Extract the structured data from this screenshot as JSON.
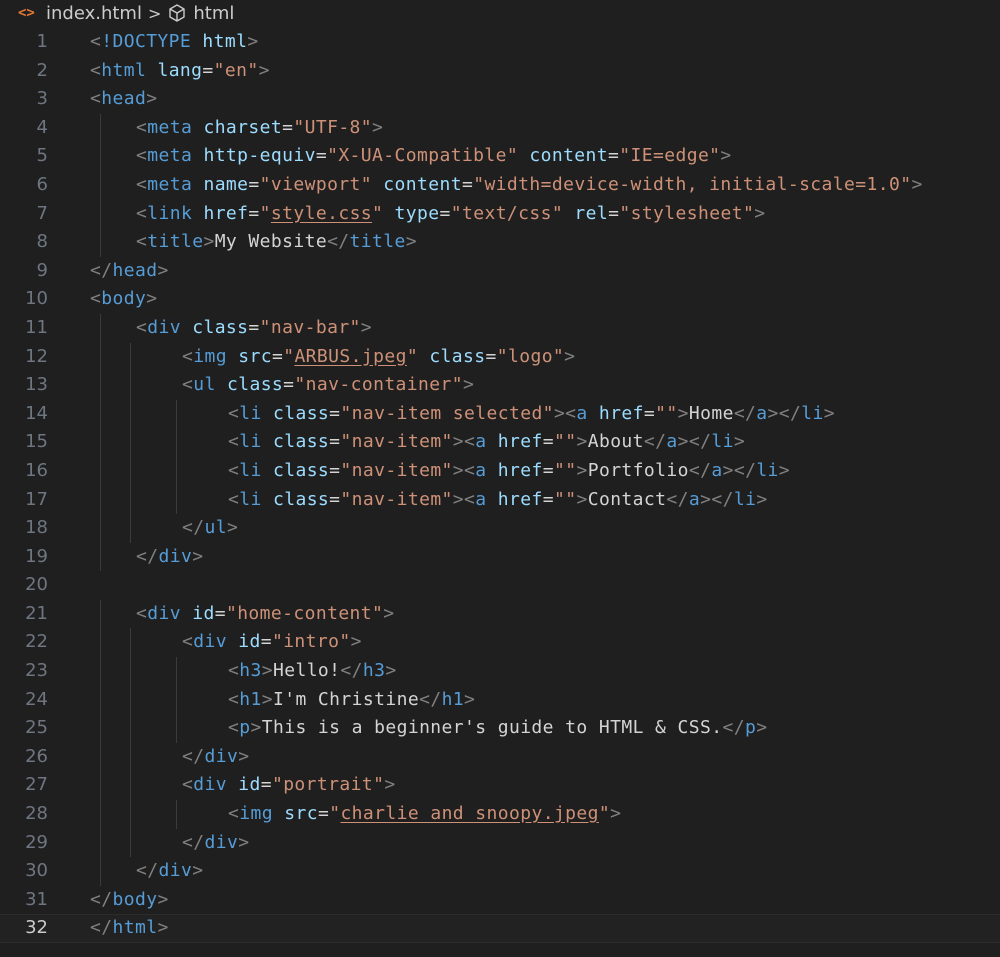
{
  "breadcrumb": {
    "file": "index.html",
    "separator": ">",
    "symbol": "html",
    "file_icon": "html-file-icon",
    "symbol_icon": "cube-icon"
  },
  "editor": {
    "current_line": 32,
    "lines": [
      {
        "n": "1",
        "indent": 0,
        "tokens": [
          [
            "p",
            "<"
          ],
          [
            "t",
            "!DOCTYPE"
          ],
          [
            "x",
            " "
          ],
          [
            "a",
            "html"
          ],
          [
            "p",
            ">"
          ]
        ]
      },
      {
        "n": "2",
        "indent": 0,
        "tokens": [
          [
            "p",
            "<"
          ],
          [
            "t",
            "html"
          ],
          [
            "x",
            " "
          ],
          [
            "a",
            "lang"
          ],
          [
            "x",
            "="
          ],
          [
            "s",
            "\"en\""
          ],
          [
            "p",
            ">"
          ]
        ]
      },
      {
        "n": "3",
        "indent": 0,
        "tokens": [
          [
            "p",
            "<"
          ],
          [
            "t",
            "head"
          ],
          [
            "p",
            ">"
          ]
        ]
      },
      {
        "n": "4",
        "indent": 1,
        "tokens": [
          [
            "p",
            "<"
          ],
          [
            "t",
            "meta"
          ],
          [
            "x",
            " "
          ],
          [
            "a",
            "charset"
          ],
          [
            "x",
            "="
          ],
          [
            "s",
            "\"UTF-8\""
          ],
          [
            "p",
            ">"
          ]
        ]
      },
      {
        "n": "5",
        "indent": 1,
        "tokens": [
          [
            "p",
            "<"
          ],
          [
            "t",
            "meta"
          ],
          [
            "x",
            " "
          ],
          [
            "a",
            "http-equiv"
          ],
          [
            "x",
            "="
          ],
          [
            "s",
            "\"X-UA-Compatible\""
          ],
          [
            "x",
            " "
          ],
          [
            "a",
            "content"
          ],
          [
            "x",
            "="
          ],
          [
            "s",
            "\"IE=edge\""
          ],
          [
            "p",
            ">"
          ]
        ]
      },
      {
        "n": "6",
        "indent": 1,
        "tokens": [
          [
            "p",
            "<"
          ],
          [
            "t",
            "meta"
          ],
          [
            "x",
            " "
          ],
          [
            "a",
            "name"
          ],
          [
            "x",
            "="
          ],
          [
            "s",
            "\"viewport\""
          ],
          [
            "x",
            " "
          ],
          [
            "a",
            "content"
          ],
          [
            "x",
            "="
          ],
          [
            "s",
            "\"width=device-width, initial-scale=1.0\""
          ],
          [
            "p",
            ">"
          ]
        ]
      },
      {
        "n": "7",
        "indent": 1,
        "tokens": [
          [
            "p",
            "<"
          ],
          [
            "t",
            "link"
          ],
          [
            "x",
            " "
          ],
          [
            "a",
            "href"
          ],
          [
            "x",
            "="
          ],
          [
            "s",
            "\""
          ],
          [
            "u",
            "style.css"
          ],
          [
            "s",
            "\""
          ],
          [
            "x",
            " "
          ],
          [
            "a",
            "type"
          ],
          [
            "x",
            "="
          ],
          [
            "s",
            "\"text/css\""
          ],
          [
            "x",
            " "
          ],
          [
            "a",
            "rel"
          ],
          [
            "x",
            "="
          ],
          [
            "s",
            "\"stylesheet\""
          ],
          [
            "p",
            ">"
          ]
        ]
      },
      {
        "n": "8",
        "indent": 1,
        "tokens": [
          [
            "p",
            "<"
          ],
          [
            "t",
            "title"
          ],
          [
            "p",
            ">"
          ],
          [
            "x",
            "My Website"
          ],
          [
            "p",
            "</"
          ],
          [
            "t",
            "title"
          ],
          [
            "p",
            ">"
          ]
        ]
      },
      {
        "n": "9",
        "indent": 0,
        "tokens": [
          [
            "p",
            "</"
          ],
          [
            "t",
            "head"
          ],
          [
            "p",
            ">"
          ]
        ]
      },
      {
        "n": "10",
        "indent": 0,
        "tokens": [
          [
            "p",
            "<"
          ],
          [
            "t",
            "body"
          ],
          [
            "p",
            ">"
          ]
        ]
      },
      {
        "n": "11",
        "indent": 1,
        "tokens": [
          [
            "p",
            "<"
          ],
          [
            "t",
            "div"
          ],
          [
            "x",
            " "
          ],
          [
            "a",
            "class"
          ],
          [
            "x",
            "="
          ],
          [
            "s",
            "\"nav-bar\""
          ],
          [
            "p",
            ">"
          ]
        ]
      },
      {
        "n": "12",
        "indent": 2,
        "tokens": [
          [
            "p",
            "<"
          ],
          [
            "t",
            "img"
          ],
          [
            "x",
            " "
          ],
          [
            "a",
            "src"
          ],
          [
            "x",
            "="
          ],
          [
            "s",
            "\""
          ],
          [
            "u",
            "ARBUS.jpeg"
          ],
          [
            "s",
            "\""
          ],
          [
            "x",
            " "
          ],
          [
            "a",
            "class"
          ],
          [
            "x",
            "="
          ],
          [
            "s",
            "\"logo\""
          ],
          [
            "p",
            ">"
          ]
        ]
      },
      {
        "n": "13",
        "indent": 2,
        "tokens": [
          [
            "p",
            "<"
          ],
          [
            "t",
            "ul"
          ],
          [
            "x",
            " "
          ],
          [
            "a",
            "class"
          ],
          [
            "x",
            "="
          ],
          [
            "s",
            "\"nav-container\""
          ],
          [
            "p",
            ">"
          ]
        ]
      },
      {
        "n": "14",
        "indent": 3,
        "tokens": [
          [
            "p",
            "<"
          ],
          [
            "t",
            "li"
          ],
          [
            "x",
            " "
          ],
          [
            "a",
            "class"
          ],
          [
            "x",
            "="
          ],
          [
            "s",
            "\"nav-item selected\""
          ],
          [
            "p",
            "><"
          ],
          [
            "t",
            "a"
          ],
          [
            "x",
            " "
          ],
          [
            "a",
            "href"
          ],
          [
            "x",
            "="
          ],
          [
            "s",
            "\"\""
          ],
          [
            "p",
            ">"
          ],
          [
            "x",
            "Home"
          ],
          [
            "p",
            "</"
          ],
          [
            "t",
            "a"
          ],
          [
            "p",
            "></"
          ],
          [
            "t",
            "li"
          ],
          [
            "p",
            ">"
          ]
        ]
      },
      {
        "n": "15",
        "indent": 3,
        "tokens": [
          [
            "p",
            "<"
          ],
          [
            "t",
            "li"
          ],
          [
            "x",
            " "
          ],
          [
            "a",
            "class"
          ],
          [
            "x",
            "="
          ],
          [
            "s",
            "\"nav-item\""
          ],
          [
            "p",
            "><"
          ],
          [
            "t",
            "a"
          ],
          [
            "x",
            " "
          ],
          [
            "a",
            "href"
          ],
          [
            "x",
            "="
          ],
          [
            "s",
            "\"\""
          ],
          [
            "p",
            ">"
          ],
          [
            "x",
            "About"
          ],
          [
            "p",
            "</"
          ],
          [
            "t",
            "a"
          ],
          [
            "p",
            "></"
          ],
          [
            "t",
            "li"
          ],
          [
            "p",
            ">"
          ]
        ]
      },
      {
        "n": "16",
        "indent": 3,
        "tokens": [
          [
            "p",
            "<"
          ],
          [
            "t",
            "li"
          ],
          [
            "x",
            " "
          ],
          [
            "a",
            "class"
          ],
          [
            "x",
            "="
          ],
          [
            "s",
            "\"nav-item\""
          ],
          [
            "p",
            "><"
          ],
          [
            "t",
            "a"
          ],
          [
            "x",
            " "
          ],
          [
            "a",
            "href"
          ],
          [
            "x",
            "="
          ],
          [
            "s",
            "\"\""
          ],
          [
            "p",
            ">"
          ],
          [
            "x",
            "Portfolio"
          ],
          [
            "p",
            "</"
          ],
          [
            "t",
            "a"
          ],
          [
            "p",
            "></"
          ],
          [
            "t",
            "li"
          ],
          [
            "p",
            ">"
          ]
        ]
      },
      {
        "n": "17",
        "indent": 3,
        "tokens": [
          [
            "p",
            "<"
          ],
          [
            "t",
            "li"
          ],
          [
            "x",
            " "
          ],
          [
            "a",
            "class"
          ],
          [
            "x",
            "="
          ],
          [
            "s",
            "\"nav-item\""
          ],
          [
            "p",
            "><"
          ],
          [
            "t",
            "a"
          ],
          [
            "x",
            " "
          ],
          [
            "a",
            "href"
          ],
          [
            "x",
            "="
          ],
          [
            "s",
            "\"\""
          ],
          [
            "p",
            ">"
          ],
          [
            "x",
            "Contact"
          ],
          [
            "p",
            "</"
          ],
          [
            "t",
            "a"
          ],
          [
            "p",
            "></"
          ],
          [
            "t",
            "li"
          ],
          [
            "p",
            ">"
          ]
        ]
      },
      {
        "n": "18",
        "indent": 2,
        "tokens": [
          [
            "p",
            "</"
          ],
          [
            "t",
            "ul"
          ],
          [
            "p",
            ">"
          ]
        ]
      },
      {
        "n": "19",
        "indent": 1,
        "tokens": [
          [
            "p",
            "</"
          ],
          [
            "t",
            "div"
          ],
          [
            "p",
            ">"
          ]
        ]
      },
      {
        "n": "20",
        "indent": 0,
        "tokens": []
      },
      {
        "n": "21",
        "indent": 1,
        "tokens": [
          [
            "p",
            "<"
          ],
          [
            "t",
            "div"
          ],
          [
            "x",
            " "
          ],
          [
            "a",
            "id"
          ],
          [
            "x",
            "="
          ],
          [
            "s",
            "\"home-content\""
          ],
          [
            "p",
            ">"
          ]
        ]
      },
      {
        "n": "22",
        "indent": 2,
        "tokens": [
          [
            "p",
            "<"
          ],
          [
            "t",
            "div"
          ],
          [
            "x",
            " "
          ],
          [
            "a",
            "id"
          ],
          [
            "x",
            "="
          ],
          [
            "s",
            "\"intro\""
          ],
          [
            "p",
            ">"
          ]
        ]
      },
      {
        "n": "23",
        "indent": 3,
        "tokens": [
          [
            "p",
            "<"
          ],
          [
            "t",
            "h3"
          ],
          [
            "p",
            ">"
          ],
          [
            "x",
            "Hello!"
          ],
          [
            "p",
            "</"
          ],
          [
            "t",
            "h3"
          ],
          [
            "p",
            ">"
          ]
        ]
      },
      {
        "n": "24",
        "indent": 3,
        "tokens": [
          [
            "p",
            "<"
          ],
          [
            "t",
            "h1"
          ],
          [
            "p",
            ">"
          ],
          [
            "x",
            "I'm Christine"
          ],
          [
            "p",
            "</"
          ],
          [
            "t",
            "h1"
          ],
          [
            "p",
            ">"
          ]
        ]
      },
      {
        "n": "25",
        "indent": 3,
        "tokens": [
          [
            "p",
            "<"
          ],
          [
            "t",
            "p"
          ],
          [
            "p",
            ">"
          ],
          [
            "x",
            "This is a beginner's guide to HTML & CSS."
          ],
          [
            "p",
            "</"
          ],
          [
            "t",
            "p"
          ],
          [
            "p",
            ">"
          ]
        ]
      },
      {
        "n": "26",
        "indent": 2,
        "tokens": [
          [
            "p",
            "</"
          ],
          [
            "t",
            "div"
          ],
          [
            "p",
            ">"
          ]
        ]
      },
      {
        "n": "27",
        "indent": 2,
        "tokens": [
          [
            "p",
            "<"
          ],
          [
            "t",
            "div"
          ],
          [
            "x",
            " "
          ],
          [
            "a",
            "id"
          ],
          [
            "x",
            "="
          ],
          [
            "s",
            "\"portrait\""
          ],
          [
            "p",
            ">"
          ]
        ]
      },
      {
        "n": "28",
        "indent": 3,
        "tokens": [
          [
            "p",
            "<"
          ],
          [
            "t",
            "img"
          ],
          [
            "x",
            " "
          ],
          [
            "a",
            "src"
          ],
          [
            "x",
            "="
          ],
          [
            "s",
            "\""
          ],
          [
            "u",
            "charlie and snoopy.jpeg"
          ],
          [
            "s",
            "\""
          ],
          [
            "p",
            ">"
          ]
        ]
      },
      {
        "n": "29",
        "indent": 2,
        "tokens": [
          [
            "p",
            "</"
          ],
          [
            "t",
            "div"
          ],
          [
            "p",
            ">"
          ]
        ]
      },
      {
        "n": "30",
        "indent": 1,
        "tokens": [
          [
            "p",
            "</"
          ],
          [
            "t",
            "div"
          ],
          [
            "p",
            ">"
          ]
        ]
      },
      {
        "n": "31",
        "indent": 0,
        "tokens": [
          [
            "p",
            "</"
          ],
          [
            "t",
            "body"
          ],
          [
            "p",
            ">"
          ]
        ]
      },
      {
        "n": "32",
        "indent": 0,
        "tokens": [
          [
            "p",
            "</"
          ],
          [
            "t",
            "html"
          ],
          [
            "p",
            ">"
          ]
        ]
      }
    ]
  }
}
